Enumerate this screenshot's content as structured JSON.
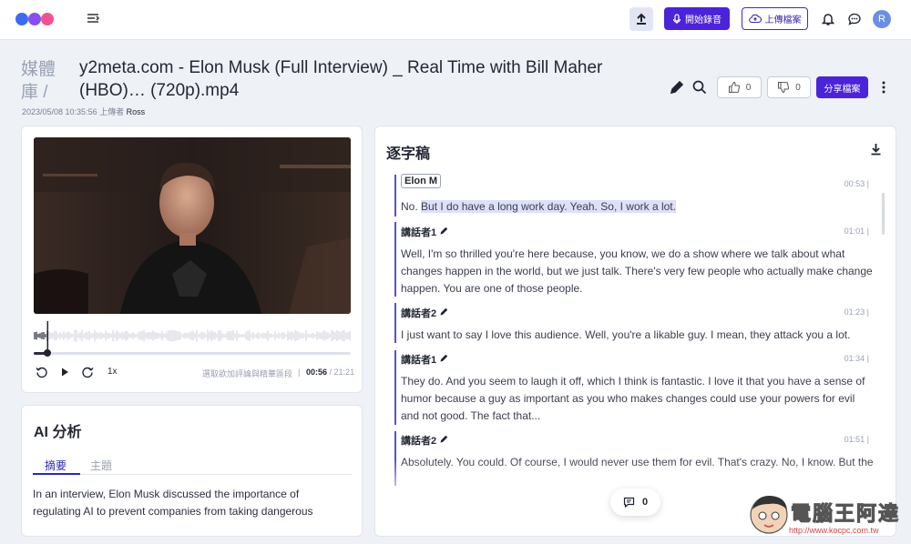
{
  "header": {
    "record_label": "開始錄音",
    "upload_label": "上傳檔案",
    "avatar_initial": "R"
  },
  "file": {
    "breadcrumb": "媒體庫 /",
    "title": "y2meta.com - Elon Musk (Full Interview) _ Real Time with Bill Maher (HBO)… (720p).mp4",
    "uploaded_at": "2023/05/08 10:35:56 上傳者",
    "uploader": "Ross",
    "likes": "0",
    "dislikes": "0",
    "share_label": "分享檔案"
  },
  "player": {
    "speed": "1x",
    "hint": "選取欲加評論與精華區段",
    "separator": "|",
    "current_time": "00:56",
    "total_time": "/ 21:21",
    "progress": 0.044
  },
  "ai": {
    "title": "AI 分析",
    "tabs": [
      "摘要",
      "主題"
    ],
    "summary": "In an interview, Elon Musk discussed the importance of regulating AI to prevent companies from taking dangerous"
  },
  "transcript": {
    "title": "逐字稿",
    "segments": [
      {
        "speaker": "Elon M",
        "time": "00:53 |",
        "text_plain": "No. ",
        "text_highlight": "But I do have a long work day. Yeah. So, I work a lot."
      },
      {
        "speaker": "講話者1",
        "time": "01:01 |",
        "text": "Well, I'm so thrilled you're here because, you know, we do a show where we talk about what changes happen in the world, but we just talk. There's very few people who actually make change happen. You are one of those people."
      },
      {
        "speaker": "講話者2",
        "time": "01:23 |",
        "text": "I just want to say I love this audience. Well, you're a likable guy. I mean, they attack you a lot."
      },
      {
        "speaker": "講話者1",
        "time": "01:34 |",
        "text": "They do. And you seem to laugh it off, which I think is fantastic. I love it that you have a sense of humor because a guy as important as you who makes changes could use your powers for evil and not good. The fact that..."
      },
      {
        "speaker": "講話者2",
        "time": "01:51 |",
        "text": "Absolutely. You could. Of course, I would never use them for evil. That's crazy. No, I know. But the"
      }
    ],
    "comment_count": "0"
  },
  "watermark": {
    "text": "電腦王阿達",
    "url": "http://www.kocpc.com.tw"
  }
}
